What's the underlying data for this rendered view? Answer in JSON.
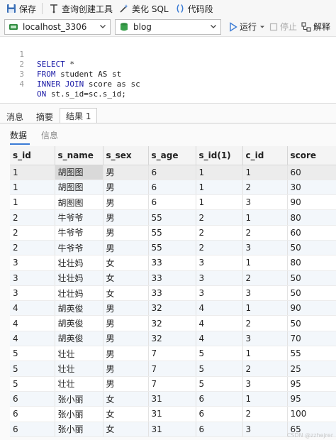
{
  "toolbar": {
    "save": "保存",
    "query_builder": "查询创建工具",
    "beautify": "美化 SQL",
    "snippet": "代码段"
  },
  "connection": {
    "host": "localhost_3306",
    "database": "blog",
    "run": "运行",
    "stop": "停止",
    "explain": "解释"
  },
  "editor": {
    "line_numbers": [
      "1",
      "2",
      "3",
      "4"
    ],
    "lines": [
      {
        "kw": "SELECT",
        "rest": " *"
      },
      {
        "kw": "FROM",
        "rest": " student AS st"
      },
      {
        "kw": "INNER JOIN",
        "rest": " score as sc"
      },
      {
        "kw": "ON",
        "rest": " st.s_id=sc.s_id;"
      }
    ]
  },
  "result": {
    "tabs": [
      "消息",
      "摘要",
      "结果 1"
    ],
    "subtabs": [
      "数据",
      "信息"
    ],
    "columns": [
      "s_id",
      "s_name",
      "s_sex",
      "s_age",
      "s_id(1)",
      "c_id",
      "score"
    ],
    "rows": [
      [
        "1",
        "胡图图",
        "男",
        "6",
        "1",
        "1",
        "60"
      ],
      [
        "1",
        "胡图图",
        "男",
        "6",
        "1",
        "2",
        "30"
      ],
      [
        "1",
        "胡图图",
        "男",
        "6",
        "1",
        "3",
        "90"
      ],
      [
        "2",
        "牛爷爷",
        "男",
        "55",
        "2",
        "1",
        "80"
      ],
      [
        "2",
        "牛爷爷",
        "男",
        "55",
        "2",
        "2",
        "60"
      ],
      [
        "2",
        "牛爷爷",
        "男",
        "55",
        "2",
        "3",
        "50"
      ],
      [
        "3",
        "壮壮妈",
        "女",
        "33",
        "3",
        "1",
        "80"
      ],
      [
        "3",
        "壮壮妈",
        "女",
        "33",
        "3",
        "2",
        "50"
      ],
      [
        "3",
        "壮壮妈",
        "女",
        "33",
        "3",
        "3",
        "50"
      ],
      [
        "4",
        "胡英俊",
        "男",
        "32",
        "4",
        "1",
        "90"
      ],
      [
        "4",
        "胡英俊",
        "男",
        "32",
        "4",
        "2",
        "50"
      ],
      [
        "4",
        "胡英俊",
        "男",
        "32",
        "4",
        "3",
        "70"
      ],
      [
        "5",
        "壮壮",
        "男",
        "7",
        "5",
        "1",
        "55"
      ],
      [
        "5",
        "壮壮",
        "男",
        "7",
        "5",
        "2",
        "25"
      ],
      [
        "5",
        "壮壮",
        "男",
        "7",
        "5",
        "3",
        "95"
      ],
      [
        "6",
        "张小丽",
        "女",
        "31",
        "6",
        "1",
        "95"
      ],
      [
        "6",
        "张小丽",
        "女",
        "31",
        "6",
        "2",
        "100"
      ],
      [
        "6",
        "张小丽",
        "女",
        "31",
        "6",
        "3",
        "65"
      ]
    ]
  },
  "watermark": "CSDN @zzhejrer"
}
